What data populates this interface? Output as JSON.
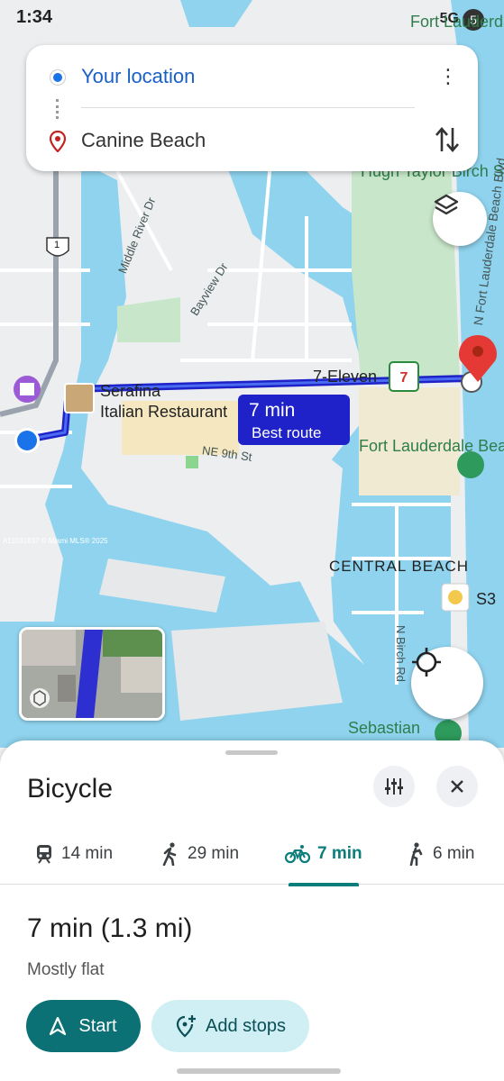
{
  "status_bar": {
    "time": "1:34",
    "network": "5G"
  },
  "directions": {
    "origin": "Your location",
    "destination": "Canine Beach"
  },
  "map": {
    "labels": {
      "fort_lauderdale_top": "Fort Lauderdale",
      "hugh_taylor_birch": "Hugh Taylor Birch State Park",
      "middle_river_dr": "Middle River Dr",
      "bayview_dr": "Bayview Dr",
      "n_fort_lauderdale_beach_blvd": "N Fort Lauderdale Beach Blvd",
      "seven_eleven": "7-Eleven",
      "serafina_line1": "Serafina",
      "serafina_line2": "Italian Restaurant",
      "ne_9th_st": "NE 9th St",
      "fort_lauderdale_beach": "Fort Lauderdale Beach",
      "central_beach": "CENTRAL BEACH",
      "s3": "S3",
      "n_birch_rd": "N Birch Rd",
      "sebastian": "Sebastian",
      "us_route": "1",
      "watermark": "A11031837 © Miami MLS® 2025"
    },
    "route_badge": {
      "time": "7 min",
      "label": "Best route"
    }
  },
  "sheet": {
    "mode_title": "Bicycle",
    "tabs": [
      {
        "mode": "transit",
        "time": "14 min"
      },
      {
        "mode": "walk",
        "time": "29 min"
      },
      {
        "mode": "bicycle",
        "time": "7 min",
        "active": true
      },
      {
        "mode": "rideshare",
        "time": "6 min"
      }
    ],
    "summary": "7 min (1.3 mi)",
    "terrain": "Mostly flat",
    "start_label": "Start",
    "add_stops_label": "Add stops"
  },
  "colors": {
    "route": "#1e22c8",
    "accent_teal": "#0b7175",
    "water": "#8fd3ee",
    "park": "#c8e6c9",
    "origin_blue": "#1a73e8",
    "pin_red": "#e53935"
  }
}
